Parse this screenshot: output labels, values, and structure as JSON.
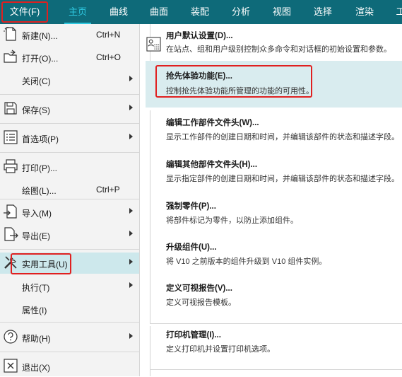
{
  "ribbon": {
    "tabs": [
      {
        "label": "文件(F)",
        "state": "file"
      },
      {
        "label": "主页",
        "state": "active"
      },
      {
        "label": "曲线"
      },
      {
        "label": "曲面"
      },
      {
        "label": "装配"
      },
      {
        "label": "分析"
      },
      {
        "label": "视图"
      },
      {
        "label": "选择"
      },
      {
        "label": "渲染"
      },
      {
        "label": "工"
      }
    ]
  },
  "file_menu": {
    "items": [
      {
        "label": "新建(N)...",
        "shortcut": "Ctrl+N",
        "icon": "new-file-icon"
      },
      {
        "label": "打开(O)...",
        "shortcut": "Ctrl+O",
        "icon": "open-folder-icon"
      },
      {
        "label": "关闭(C)",
        "icon": "none"
      },
      {
        "label": "保存(S)",
        "icon": "save-icon"
      },
      {
        "label": "首选项(P)",
        "icon": "preferences-icon"
      },
      {
        "label": "打印(P)...",
        "icon": "printer-icon"
      },
      {
        "label": "绘图(L)...",
        "shortcut": "Ctrl+P",
        "icon": "none"
      },
      {
        "label": "导入(M)",
        "icon": "import-icon"
      },
      {
        "label": "导出(E)",
        "icon": "export-icon"
      },
      {
        "label": "实用工具(U)",
        "icon": "utilities-icon",
        "selected": true
      },
      {
        "label": "执行(T)",
        "icon": "none"
      },
      {
        "label": "属性(I)",
        "icon": "none"
      },
      {
        "label": "帮助(H)",
        "icon": "help-icon"
      },
      {
        "label": "退出(X)",
        "icon": "exit-icon"
      }
    ]
  },
  "utilities_submenu": {
    "items": [
      {
        "title": "用户默认设置(D)...",
        "desc": "在站点、组和用户级别控制众多命令和对话框的初始设置和参数。",
        "icon": "user-defaults-icon"
      },
      {
        "title": "抢先体验功能(E)...",
        "desc": "控制抢先体验功能所管理的功能的可用性。",
        "highlighted": true
      },
      {
        "title": "编辑工作部件文件头(W)...",
        "desc": "显示工作部件的创建日期和时间，并编辑该部件的状态和描述字段。"
      },
      {
        "title": "编辑其他部件文件头(H)...",
        "desc": "显示指定部件的创建日期和时间，并编辑该部件的状态和描述字段。"
      },
      {
        "title": "强制零件(P)...",
        "desc": "将部件标记为零件，以防止添加组件。"
      },
      {
        "title": "升级组件(U)...",
        "desc": "将 V10 之前版本的组件升级到 V10 组件实例。"
      },
      {
        "title": "定义可视报告(V)...",
        "desc": "定义可视报告模板。"
      },
      {
        "title": "打印机管理(I)...",
        "desc": "定义打印机并设置打印机选项。"
      }
    ]
  },
  "colors": {
    "ribbon_bg": "#0e6a79",
    "active_tab": "#2ec8e0",
    "selected_item_bg": "#cde8ec",
    "highlight_bg": "#d9ecef",
    "annotation_red": "#e02020"
  }
}
